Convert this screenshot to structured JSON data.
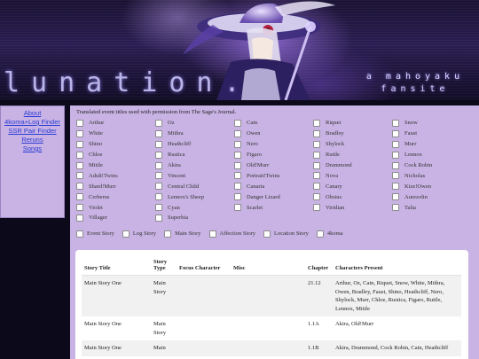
{
  "banner": {
    "title": "lunation.",
    "subtitle_line1": "a mahoyaku",
    "subtitle_line2": "fansite"
  },
  "sidebar": {
    "links": [
      "About",
      "4koma+Log Finder",
      "SSR Pair Finder",
      "Reruns",
      "Songs"
    ]
  },
  "main": {
    "note": "Translated event titles used with permission from The Sage's Journal.",
    "characters": [
      "Arthur",
      "Oz",
      "Cain",
      "Riquet",
      "Snow",
      "White",
      "Mithra",
      "Owen",
      "Bradley",
      "Faust",
      "Shino",
      "Heathcliff",
      "Nero",
      "Shylock",
      "Murr",
      "Chloe",
      "Rustica",
      "Figaro",
      "Rutile",
      "Lennox",
      "Mitile",
      "Akira",
      "Old!Murr",
      "Drammond",
      "Cock Robin",
      "Adult!Twins",
      "Vincent",
      "Portrait!Twins",
      "Nova",
      "Nicholas",
      "Shard!Murr",
      "Central Child",
      "Canaria",
      "Canary",
      "Kize!Owen",
      "Cerberus",
      "Lennox's Sheep",
      "Danger Lizard",
      "Obsius",
      "Aurezolin",
      "Violet",
      "Cyan",
      "Scarlet",
      "Viridian",
      "Talia",
      "Villager",
      "Superbia"
    ],
    "story_types": [
      "Event Story",
      "Log Story",
      "Main Story",
      "Affection Story",
      "Location Story",
      "4koma"
    ]
  },
  "table": {
    "headers": [
      "Story Title",
      "Story Type",
      "Focus Character",
      "Misc",
      "Chapter",
      "Characters Present"
    ],
    "rows": [
      {
        "title": "Main Story One",
        "type": "Main Story",
        "focus": "",
        "misc": "",
        "chapter": "21.12",
        "characters": "Arthur, Oz, Cain, Riquet, Snow, White, Mithra, Owen, Bradley, Faust, Shino, Heathcliff, Nero, Shylock, Murr, Chloe, Rustica, Figaro, Rutile, Lennox, Mitile"
      },
      {
        "title": "Main Story One",
        "type": "Main Story",
        "focus": "",
        "misc": "",
        "chapter": "1.1A",
        "characters": "Akira, Old!Murr"
      },
      {
        "title": "Main Story One",
        "type": "Main",
        "focus": "",
        "misc": "",
        "chapter": "1.1B",
        "characters": "Akira, Drammond, Cock Robin, Cain, Heathcliff"
      }
    ]
  }
}
